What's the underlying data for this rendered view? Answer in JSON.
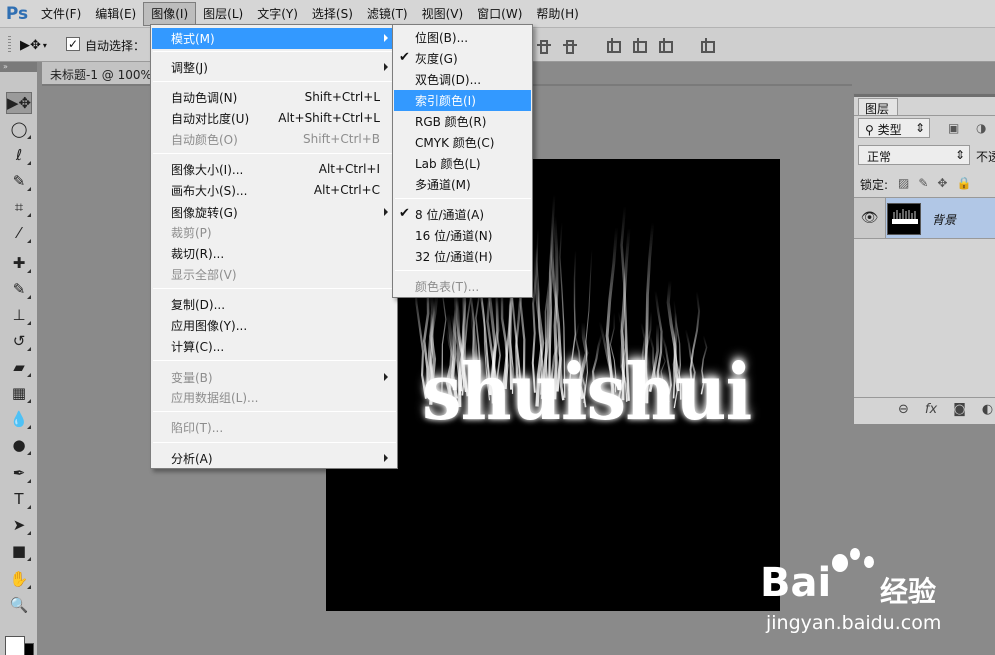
{
  "app": {
    "logo": "Ps",
    "brand_color": "#2f6fb3"
  },
  "menubar": {
    "items": [
      "文件(F)",
      "编辑(E)",
      "图像(I)",
      "图层(L)",
      "文字(Y)",
      "选择(S)",
      "滤镜(T)",
      "视图(V)",
      "窗口(W)",
      "帮助(H)"
    ],
    "active_index": 2
  },
  "options": {
    "auto_select_label": "自动选择：",
    "auto_select_checked": true
  },
  "document": {
    "tab_title": "未标题-1 @ 100%"
  },
  "canvas": {
    "text": "shuishui"
  },
  "image_menu": {
    "items": [
      {
        "label": "模式(M)",
        "shortcut": "",
        "submenu": true,
        "highlighted": true,
        "disabled": false
      },
      {
        "label": "调整(J)",
        "shortcut": "",
        "submenu": true,
        "highlighted": false,
        "disabled": false
      },
      {
        "label": "自动色调(N)",
        "shortcut": "Shift+Ctrl+L",
        "submenu": false,
        "highlighted": false,
        "disabled": false
      },
      {
        "label": "自动对比度(U)",
        "shortcut": "Alt+Shift+Ctrl+L",
        "submenu": false,
        "highlighted": false,
        "disabled": false
      },
      {
        "label": "自动颜色(O)",
        "shortcut": "Shift+Ctrl+B",
        "submenu": false,
        "highlighted": false,
        "disabled": true
      },
      {
        "label": "图像大小(I)...",
        "shortcut": "Alt+Ctrl+I",
        "submenu": false,
        "highlighted": false,
        "disabled": false
      },
      {
        "label": "画布大小(S)...",
        "shortcut": "Alt+Ctrl+C",
        "submenu": false,
        "highlighted": false,
        "disabled": false
      },
      {
        "label": "图像旋转(G)",
        "shortcut": "",
        "submenu": true,
        "highlighted": false,
        "disabled": false
      },
      {
        "label": "裁剪(P)",
        "shortcut": "",
        "submenu": false,
        "highlighted": false,
        "disabled": true
      },
      {
        "label": "裁切(R)...",
        "shortcut": "",
        "submenu": false,
        "highlighted": false,
        "disabled": false
      },
      {
        "label": "显示全部(V)",
        "shortcut": "",
        "submenu": false,
        "highlighted": false,
        "disabled": true
      },
      {
        "label": "复制(D)...",
        "shortcut": "",
        "submenu": false,
        "highlighted": false,
        "disabled": false
      },
      {
        "label": "应用图像(Y)...",
        "shortcut": "",
        "submenu": false,
        "highlighted": false,
        "disabled": false
      },
      {
        "label": "计算(C)...",
        "shortcut": "",
        "submenu": false,
        "highlighted": false,
        "disabled": false
      },
      {
        "label": "变量(B)",
        "shortcut": "",
        "submenu": true,
        "highlighted": false,
        "disabled": true
      },
      {
        "label": "应用数据组(L)...",
        "shortcut": "",
        "submenu": false,
        "highlighted": false,
        "disabled": true
      },
      {
        "label": "陷印(T)...",
        "shortcut": "",
        "submenu": false,
        "highlighted": false,
        "disabled": true
      },
      {
        "label": "分析(A)",
        "shortcut": "",
        "submenu": true,
        "highlighted": false,
        "disabled": false
      }
    ]
  },
  "mode_menu": {
    "items": [
      {
        "label": "位图(B)...",
        "checked": false,
        "highlighted": false,
        "disabled": false
      },
      {
        "label": "灰度(G)",
        "checked": true,
        "highlighted": false,
        "disabled": false
      },
      {
        "label": "双色调(D)...",
        "checked": false,
        "highlighted": false,
        "disabled": false
      },
      {
        "label": "索引颜色(I)",
        "checked": false,
        "highlighted": true,
        "disabled": false
      },
      {
        "label": "RGB 颜色(R)",
        "checked": false,
        "highlighted": false,
        "disabled": false
      },
      {
        "label": "CMYK 颜色(C)",
        "checked": false,
        "highlighted": false,
        "disabled": false
      },
      {
        "label": "Lab 颜色(L)",
        "checked": false,
        "highlighted": false,
        "disabled": false
      },
      {
        "label": "多通道(M)",
        "checked": false,
        "highlighted": false,
        "disabled": false
      },
      {
        "label": "8 位/通道(A)",
        "checked": true,
        "highlighted": false,
        "disabled": false
      },
      {
        "label": "16 位/通道(N)",
        "checked": false,
        "highlighted": false,
        "disabled": false
      },
      {
        "label": "32 位/通道(H)",
        "checked": false,
        "highlighted": false,
        "disabled": false
      },
      {
        "label": "颜色表(T)...",
        "checked": false,
        "highlighted": false,
        "disabled": true
      }
    ]
  },
  "layers_panel": {
    "tab_label": "图层",
    "kind_filter": "类型",
    "blend_mode": "正常",
    "opacity_label": "不透",
    "lock_label": "锁定:",
    "layer_name": "背景"
  },
  "watermark": {
    "logo": "Bai",
    "logo_suffix": "经验",
    "url": "jingyan.baidu.com"
  },
  "colors": {
    "highlight": "#3399ff",
    "menu_bg": "#f0f0f0",
    "disabled_text": "#8d8d8d",
    "selected_layer": "#b1c7e6"
  }
}
